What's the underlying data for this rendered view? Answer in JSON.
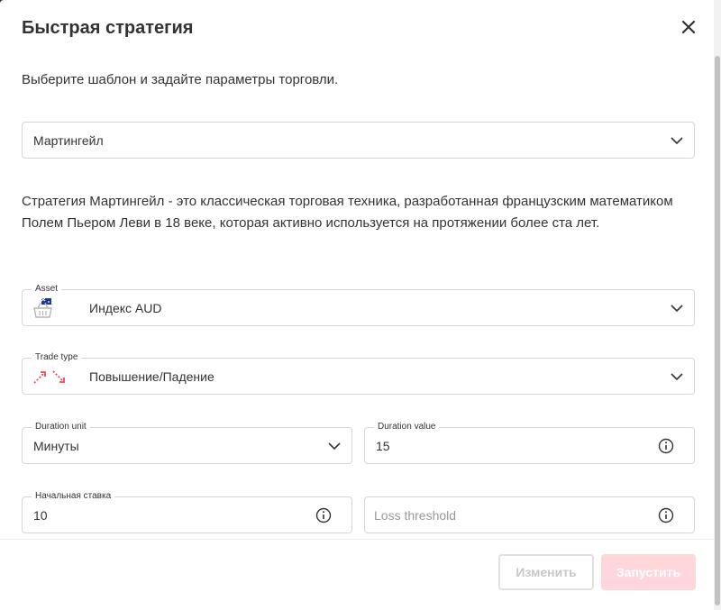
{
  "dialog": {
    "title": "Быстрая стратегия",
    "subtitle": "Выберите шаблон и задайте параметры торговли.",
    "description": "Стратегия Мартингейл - это классическая торговая техника, разработанная французским математиком Полем Пьером Леви в 18 веке, которая активно используется на протяжении более ста лет."
  },
  "strategy_select": {
    "value": "Мартингейл"
  },
  "asset": {
    "label": "Asset",
    "value": "Индекс AUD"
  },
  "trade_type": {
    "label": "Trade type",
    "value": "Повышение/Падение"
  },
  "duration_unit": {
    "label": "Duration unit",
    "value": "Минуты"
  },
  "duration_value": {
    "label": "Duration value",
    "value": "15"
  },
  "initial_stake": {
    "label": "Начальная ставка",
    "value": "10"
  },
  "loss_threshold": {
    "placeholder": "Loss threshold"
  },
  "buttons": {
    "edit": "Изменить",
    "run": "Запустить"
  },
  "colors": {
    "accent": "#ff444f",
    "disabled_run": "#ffd7da",
    "border": "#d6d6d6"
  }
}
